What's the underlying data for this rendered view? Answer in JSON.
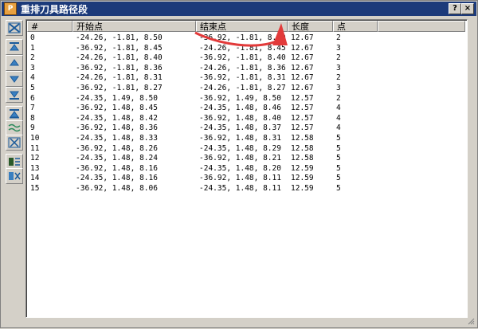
{
  "window": {
    "title": "重排刀具路径段",
    "help_label": "?",
    "close_label": "×"
  },
  "toolbar": {
    "tools": [
      {
        "name": "close-path-icon"
      },
      {
        "name": "move-top-icon"
      },
      {
        "name": "move-up-icon"
      },
      {
        "name": "move-down-icon"
      },
      {
        "name": "move-bottom-icon"
      },
      {
        "name": "reverse-icon"
      },
      {
        "name": "zigzag-icon"
      },
      {
        "name": "split-icon"
      },
      {
        "name": "sort-icon"
      },
      {
        "name": "reorder-icon"
      }
    ]
  },
  "table": {
    "headers": [
      "#",
      "开始点",
      "结束点",
      "长度",
      "点"
    ],
    "rows": [
      [
        "0",
        "-24.26, -1.81, 8.50",
        "-36.92, -1.81, 8.50",
        "12.67",
        "2"
      ],
      [
        "1",
        "-36.92, -1.81, 8.45",
        "-24.26, -1.81, 8.45",
        "12.67",
        "3"
      ],
      [
        "2",
        "-24.26, -1.81, 8.40",
        "-36.92, -1.81, 8.40",
        "12.67",
        "2"
      ],
      [
        "3",
        "-36.92, -1.81, 8.36",
        "-24.26, -1.81, 8.36",
        "12.67",
        "3"
      ],
      [
        "4",
        "-24.26, -1.81, 8.31",
        "-36.92, -1.81, 8.31",
        "12.67",
        "2"
      ],
      [
        "5",
        "-36.92, -1.81, 8.27",
        "-24.26, -1.81, 8.27",
        "12.67",
        "3"
      ],
      [
        "6",
        "-24.35, 1.49, 8.50",
        "-36.92, 1.49, 8.50",
        "12.57",
        "2"
      ],
      [
        "7",
        "-36.92, 1.48, 8.45",
        "-24.35, 1.48, 8.46",
        "12.57",
        "4"
      ],
      [
        "8",
        "-24.35, 1.48, 8.42",
        "-36.92, 1.48, 8.40",
        "12.57",
        "4"
      ],
      [
        "9",
        "-36.92, 1.48, 8.36",
        "-24.35, 1.48, 8.37",
        "12.57",
        "4"
      ],
      [
        "10",
        "-24.35, 1.48, 8.33",
        "-36.92, 1.48, 8.31",
        "12.58",
        "5"
      ],
      [
        "11",
        "-36.92, 1.48, 8.26",
        "-24.35, 1.48, 8.29",
        "12.58",
        "5"
      ],
      [
        "12",
        "-24.35, 1.48, 8.24",
        "-36.92, 1.48, 8.21",
        "12.58",
        "5"
      ],
      [
        "13",
        "-36.92, 1.48, 8.16",
        "-24.35, 1.48, 8.20",
        "12.59",
        "5"
      ],
      [
        "14",
        "-24.35, 1.48, 8.16",
        "-36.92, 1.48, 8.11",
        "12.59",
        "5"
      ],
      [
        "15",
        "-36.92, 1.48, 8.06",
        "-24.35, 1.48, 8.11",
        "12.59",
        "5"
      ]
    ]
  },
  "colors": {
    "titlebar": "#1c3a7a",
    "annotation_arrow": "#e23a3a"
  }
}
